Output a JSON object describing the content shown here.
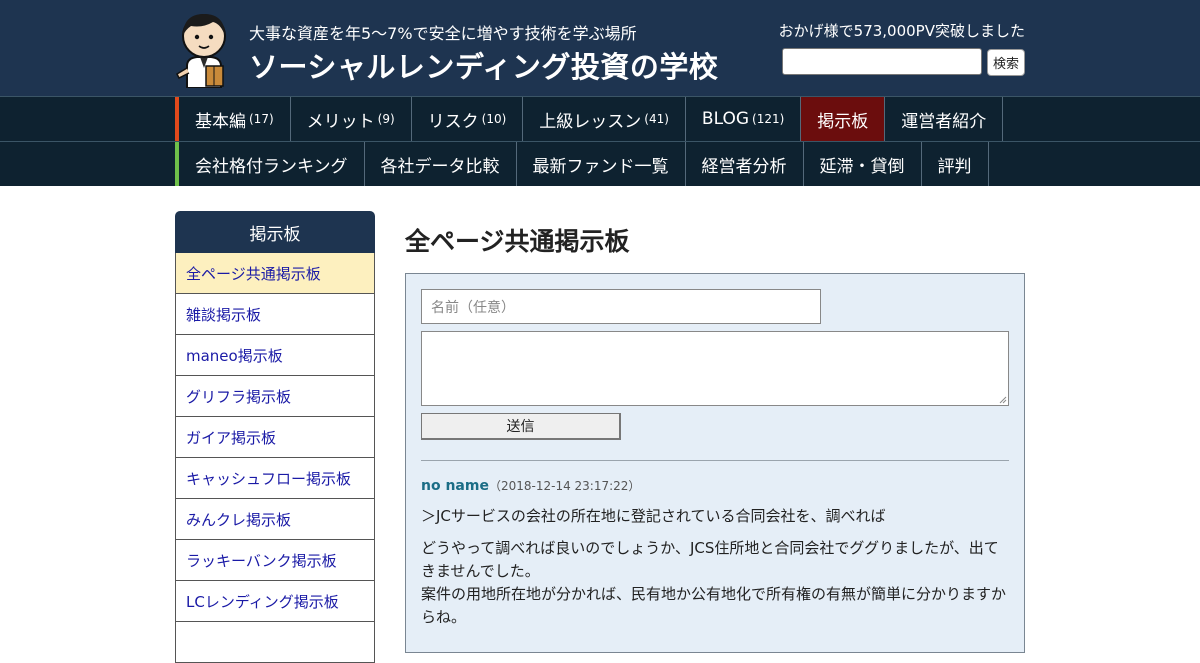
{
  "header": {
    "tagline": "大事な資産を年5～7%で安全に増やす技術を学ぶ場所",
    "site_title": "ソーシャルレンディング投資の学校",
    "pv_text": "おかげ様で573,000PV突破しました",
    "search_button": "検索",
    "avatar_icon": "mascot-avatar-icon"
  },
  "nav": {
    "row1": [
      {
        "label": "基本編",
        "count": "(17)"
      },
      {
        "label": "メリット",
        "count": "(9)"
      },
      {
        "label": "リスク",
        "count": "(10)"
      },
      {
        "label": "上級レッスン",
        "count": "(41)"
      },
      {
        "label": "BLOG",
        "count": "(121)"
      },
      {
        "label": "掲示板",
        "count": ""
      },
      {
        "label": "運営者紹介",
        "count": ""
      }
    ],
    "row2": [
      {
        "label": "会社格付ランキング"
      },
      {
        "label": "各社データ比較"
      },
      {
        "label": "最新ファンド一覧"
      },
      {
        "label": "経営者分析"
      },
      {
        "label": "延滞・貸倒"
      },
      {
        "label": "評判"
      }
    ],
    "row1_accent": "#e14a1c",
    "row2_accent": "#6fc04a",
    "active_color": "#6b0d0d"
  },
  "sidebar": {
    "title": "掲示板",
    "items": [
      "全ページ共通掲示板",
      "雑談掲示板",
      "maneo掲示板",
      "グリフラ掲示板",
      "ガイア掲示板",
      "キャッシュフロー掲示板",
      "みんクレ掲示板",
      "ラッキーバンク掲示板",
      "LCレンディング掲示板"
    ]
  },
  "main": {
    "page_title": "全ページ共通掲示板",
    "form": {
      "name_placeholder": "名前（任意）",
      "submit_label": "送信"
    },
    "post": {
      "author": "no name",
      "date": "（2018-12-14 23:17:22）",
      "quote": "＞JCサービスの会社の所在地に登記されている合同会社を、調べれば",
      "body_line1": "どうやって調べれば良いのでしょうか、JCS住所地と合同会社でググりましたが、出てきませんでした。",
      "body_line2": "案件の用地所在地が分かれば、民有地か公有地化で所有権の有無が簡単に分かりますからね。"
    }
  },
  "colors": {
    "header_bg": "#1e3450",
    "nav_bg": "#0e2230",
    "board_bg": "#e5eef7",
    "sidebar_current": "#fdf0bf",
    "link": "#1a1aa6"
  }
}
